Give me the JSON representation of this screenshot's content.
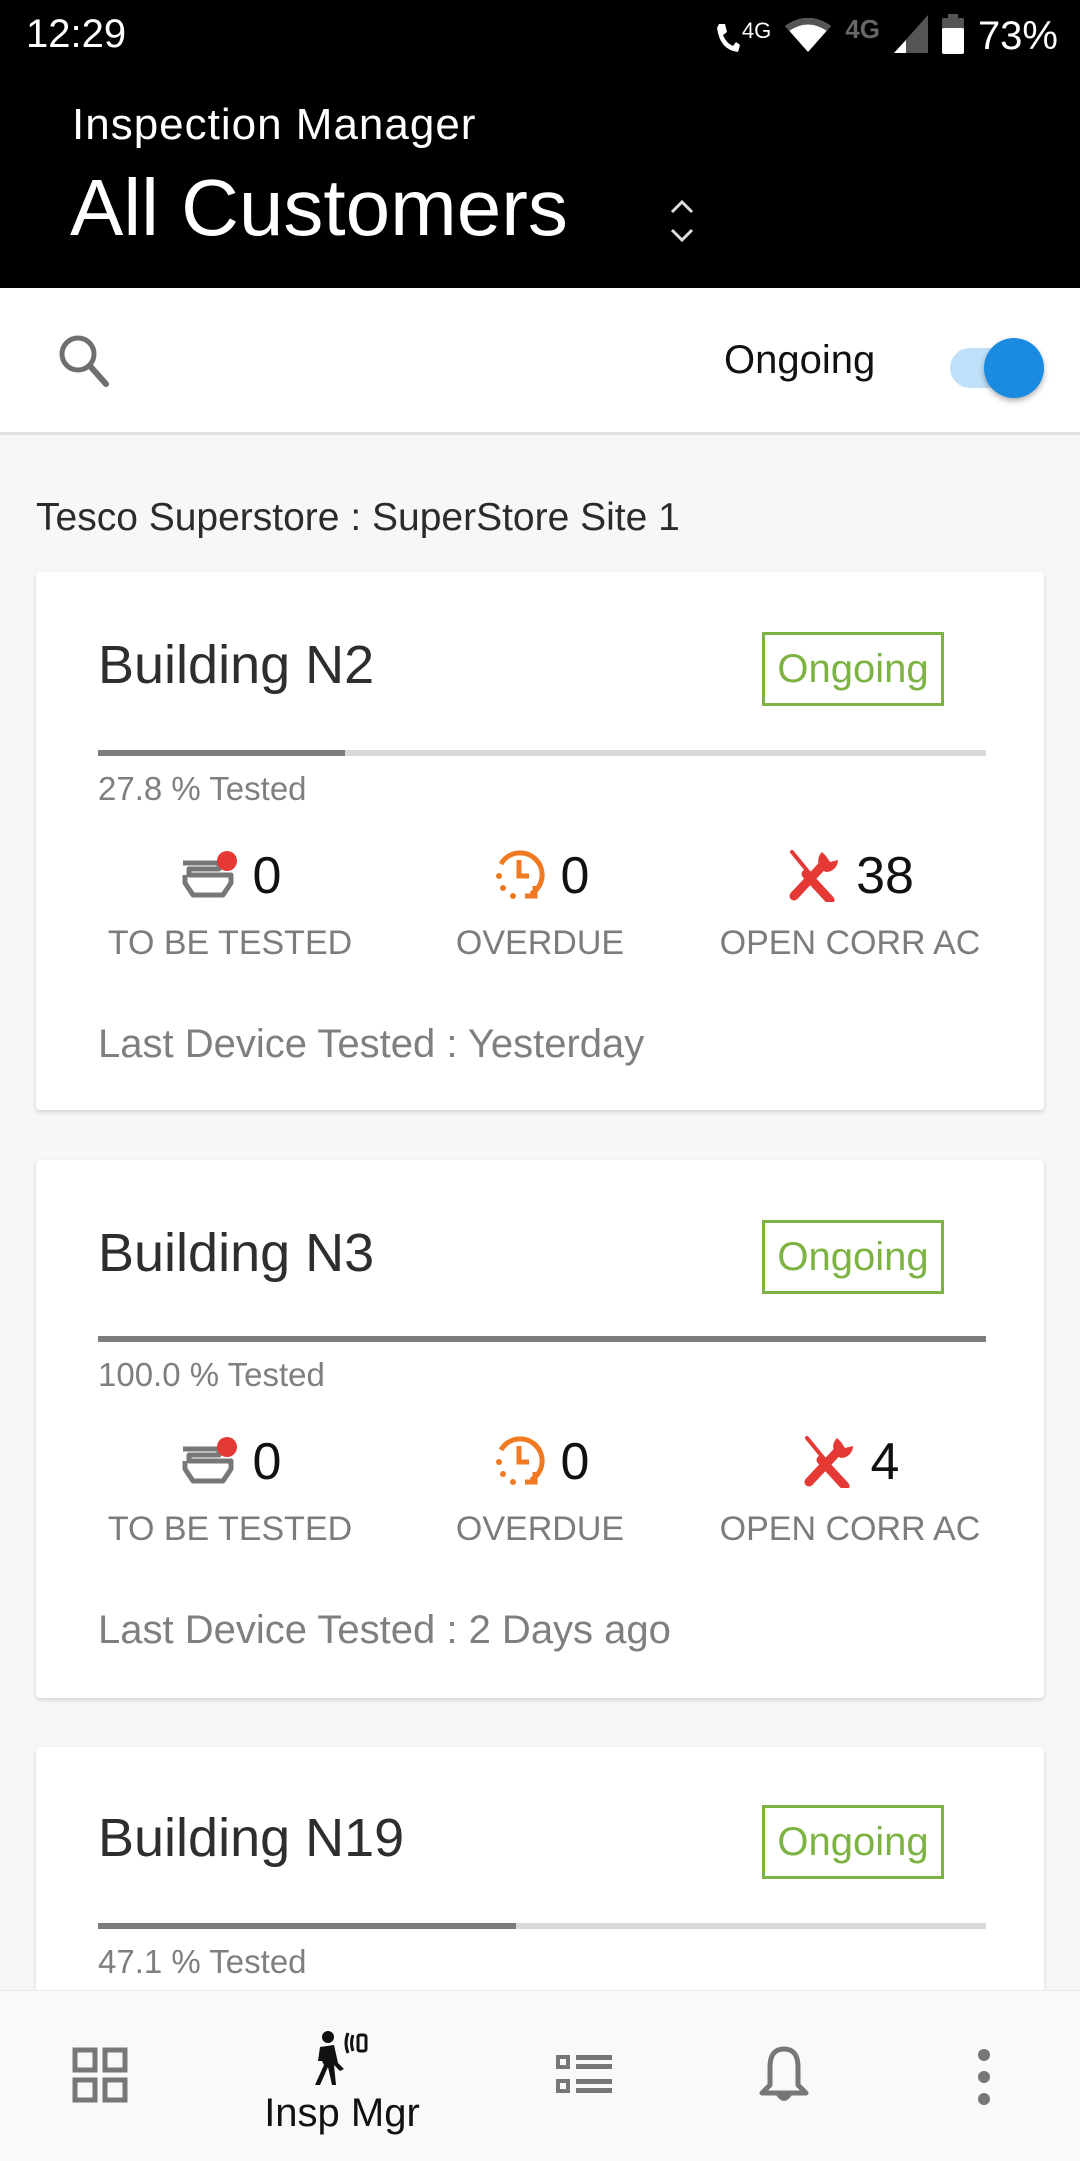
{
  "status_bar": {
    "time": "12:29",
    "call_network": "4G",
    "data_network": "4G",
    "battery_percent": "73%"
  },
  "header": {
    "subtitle": "Inspection Manager",
    "title": "All Customers"
  },
  "filter_bar": {
    "toggle_label": "Ongoing",
    "toggle_on": true,
    "toggle_color": "#1a8be0"
  },
  "site": {
    "heading": "Tesco Superstore  : SuperStore Site 1"
  },
  "stat_labels": {
    "to_be_tested": "TO BE TESTED",
    "overdue": "OVERDUE",
    "open_corr": "OPEN CORR AC"
  },
  "colors": {
    "status_ongoing": "#7cb342",
    "overdue_icon": "#f07a22",
    "corr_icon": "#e53935",
    "alert_dot": "#e53935"
  },
  "buildings": [
    {
      "name": "Building N2",
      "status": "Ongoing",
      "tested_percent": 27.8,
      "tested_text": "27.8 % Tested",
      "to_be_tested": "0",
      "overdue": "0",
      "open_corr": "38",
      "last_tested": "Last Device Tested : Yesterday"
    },
    {
      "name": "Building N3",
      "status": "Ongoing",
      "tested_percent": 100.0,
      "tested_text": "100.0 % Tested",
      "to_be_tested": "0",
      "overdue": "0",
      "open_corr": "4",
      "last_tested": "Last Device Tested : 2 Days ago"
    },
    {
      "name": "Building N19",
      "status": "Ongoing",
      "tested_percent": 47.1,
      "tested_text": "47.1 % Tested"
    }
  ],
  "bottom_nav": {
    "items": [
      {
        "icon": "dashboard-grid-icon"
      },
      {
        "icon": "inspector-walking-icon",
        "label": "Insp Mgr",
        "active": true
      },
      {
        "icon": "list-icon"
      },
      {
        "icon": "bell-icon"
      },
      {
        "icon": "more-vert-icon"
      }
    ]
  }
}
